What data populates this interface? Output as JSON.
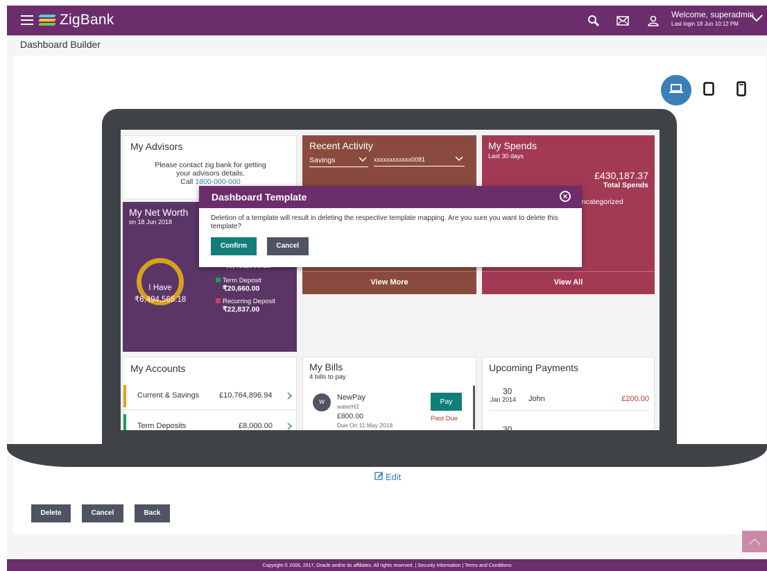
{
  "header": {
    "brand": "ZigBank",
    "welcome": "Welcome, superadmin",
    "last_login": "Last login 18 Jun 10:12 PM",
    "icons": [
      "search-icon",
      "mail-icon",
      "user-icon",
      "chevron-down-icon"
    ]
  },
  "page": {
    "title": "Dashboard Builder",
    "device_selectors": [
      "desktop-icon",
      "tablet-icon",
      "mobile-icon"
    ],
    "edit_label": "Edit",
    "buttons": {
      "delete": "Delete",
      "cancel": "Cancel",
      "back": "Back"
    }
  },
  "widgets": {
    "advisors": {
      "title": "My Advisors",
      "line1": "Please contact zig bank for getting",
      "line2": "your advisors details.",
      "call_prefix": "Call ",
      "phone": "1800-000-000"
    },
    "recent_activity": {
      "title": "Recent Activity",
      "account_type": "Savings",
      "account_no": "xxxxxxxxxxxx0081",
      "view_more": "View More"
    },
    "spends": {
      "title": "My Spends",
      "period": "Last 30 days",
      "amount": "£430,187.37",
      "amount_label": "Total Spends",
      "category": "Uncategorized",
      "view_all": "View All"
    },
    "net_worth": {
      "title": "My Net Worth",
      "date": "on 18 Jun 2018",
      "center_label": "I Have",
      "center_value": "₹6,494,565.18",
      "partial_value": "₹6,451,068.18",
      "items": [
        {
          "label": "Term Deposit",
          "value": "₹20,660.00",
          "color": "#1aa05a"
        },
        {
          "label": "Recurring Deposit",
          "value": "₹22,837.00",
          "color": "#d23c6e"
        }
      ]
    },
    "accounts": {
      "title": "My Accounts",
      "rows": [
        {
          "label": "Current & Savings",
          "value": "£10,764,896.94",
          "color": "#e5a11a"
        },
        {
          "label": "Term Deposits",
          "value": "£8,000.00",
          "color": "#1aa05a"
        }
      ]
    },
    "bills": {
      "title": "My Bills",
      "subtitle": "4 bills to pay",
      "avatar": "W",
      "payee": "NewPay",
      "biller": "waterH2",
      "amount": "£800.00",
      "due": "Due On 11 May 2018",
      "pay": "Pay",
      "status": "Past Due"
    },
    "upcoming": {
      "title": "Upcoming Payments",
      "day": "30",
      "month_year": "Jan 2014",
      "payee": "John",
      "amount": "£200.00",
      "next_day": "30"
    }
  },
  "modal": {
    "title": "Dashboard Template",
    "message": "Deletion of a template will result in deleting the respective template mapping. Are you sure you want to delete this template?",
    "confirm": "Confirm",
    "cancel": "Cancel"
  },
  "footer": {
    "text": "Copyright © 2006, 2017, Oracle and/or its affiliates. All rights reserved. | Security Information | Terms and Conditions"
  },
  "colors": {
    "brand": "#6b2d6b",
    "teal": "#127e7a",
    "activity_card": "#8b4a3f",
    "spends_card": "#a33a55",
    "networth_card": "#5b3566",
    "active_device": "#3a7fb8"
  }
}
